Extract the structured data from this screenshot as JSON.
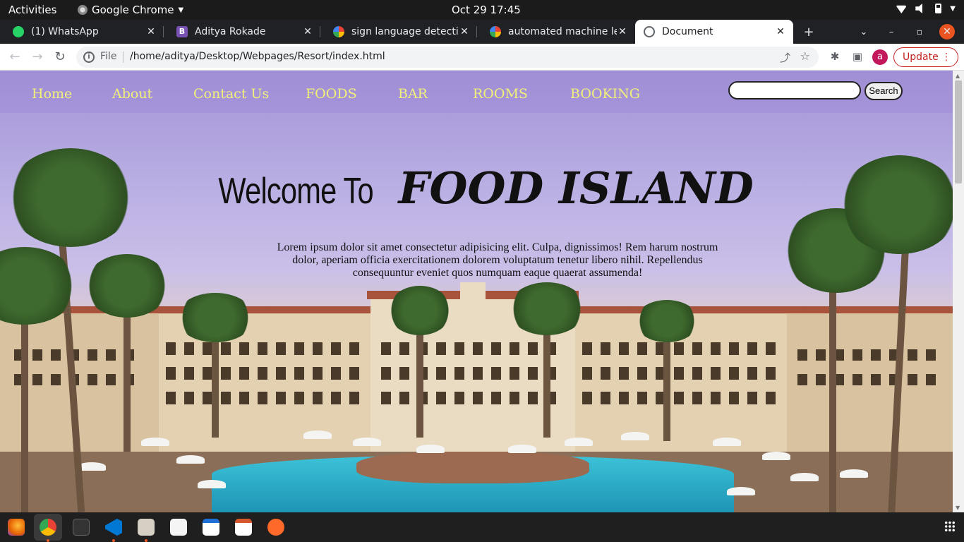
{
  "system_bar": {
    "activities": "Activities",
    "app_name": "Google Chrome",
    "clock": "Oct 29  17:45"
  },
  "tabs": [
    {
      "title": "(1) WhatsApp",
      "icon": "whatsapp-icon"
    },
    {
      "title": "Aditya Rokade",
      "icon": "bootstrap-icon"
    },
    {
      "title": "sign language detection",
      "icon": "google-icon"
    },
    {
      "title": "automated machine lea",
      "icon": "google-icon"
    },
    {
      "title": "Document",
      "icon": "globe-icon",
      "active": true
    }
  ],
  "address_bar": {
    "scheme_label": "File",
    "url": "/home/aditya/Desktop/Webpages/Resort/index.html",
    "profile_initial": "a",
    "update_label": "Update"
  },
  "page": {
    "nav": [
      "Home",
      "About",
      "Contact Us",
      "FOODS",
      "BAR",
      "ROOMS",
      "BOOKING"
    ],
    "search": {
      "value": "",
      "button": "Search"
    },
    "hero": {
      "welcome": "Welcome To",
      "brand": "FOOD ISLAND",
      "text": "Lorem ipsum dolor sit amet consectetur adipisicing elit. Culpa, dignissimos! Rem harum nostrum dolor, aperiam officia exercitationem dolorem voluptatum tenetur libero nihil. Repellendus consequuntur eveniet quos numquam eaque quaerat assumenda!"
    },
    "colors": {
      "nav_text": "#f0f07a",
      "nav_bg": "#a08cd7"
    }
  },
  "dock": [
    "firefox-icon",
    "chrome-icon",
    "terminal-icon",
    "vscode-icon",
    "files-icon",
    "text-editor-icon",
    "writer-icon",
    "impress-icon",
    "sublime-icon",
    "show-apps-icon"
  ]
}
